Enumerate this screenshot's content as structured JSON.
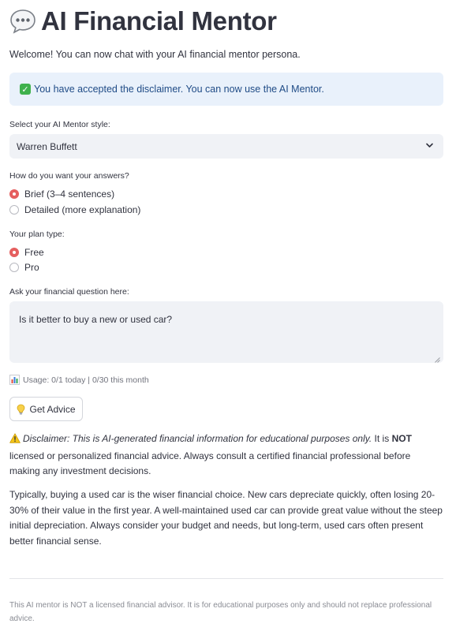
{
  "header": {
    "title": "AI Financial Mentor",
    "icon": "speech-bubble-icon"
  },
  "welcome": "Welcome! You can now chat with your AI financial mentor persona.",
  "alert": {
    "text": "You have accepted the disclaimer. You can now use the AI Mentor.",
    "icon": "check-mark-icon",
    "bg_color": "#e9f1fb",
    "text_color": "#1f4b86"
  },
  "mentor_style": {
    "label": "Select your AI Mentor style:",
    "value": "Warren Buffett"
  },
  "answer_length": {
    "label": "How do you want your answers?",
    "options": [
      "Brief (3–4 sentences)",
      "Detailed (more explanation)"
    ],
    "selected": "Brief (3–4 sentences)"
  },
  "plan": {
    "label": "Your plan type:",
    "options": [
      "Free",
      "Pro"
    ],
    "selected": "Free"
  },
  "question": {
    "label": "Ask your financial question here:",
    "value": "Is it better to buy a new or used car?"
  },
  "usage": {
    "text": "Usage: 0/1 today | 0/30 this month",
    "icon": "bar-chart-icon"
  },
  "get_advice": {
    "label": "Get Advice",
    "icon": "lightbulb-icon"
  },
  "disclaimer": {
    "icon": "warning-icon",
    "italic": "Disclaimer: This is AI-generated financial information for educational purposes only.",
    "part1": " It is ",
    "bold": "NOT",
    "part2": " licensed or personalized financial advice. Always consult a certified financial professional before making any investment decisions."
  },
  "answer": "Typically, buying a used car is the wiser financial choice. New cars depreciate quickly, often losing 20-30% of their value in the first year. A well-maintained used car can provide great value without the steep initial depreciation. Always consider your budget and needs, but long-term, used cars often present better financial sense.",
  "footer": "This AI mentor is NOT a licensed financial advisor. It is for educational purposes only and should not replace professional advice.",
  "colors": {
    "accent_radio": "#e55f5f",
    "input_bg": "#f0f2f6"
  }
}
